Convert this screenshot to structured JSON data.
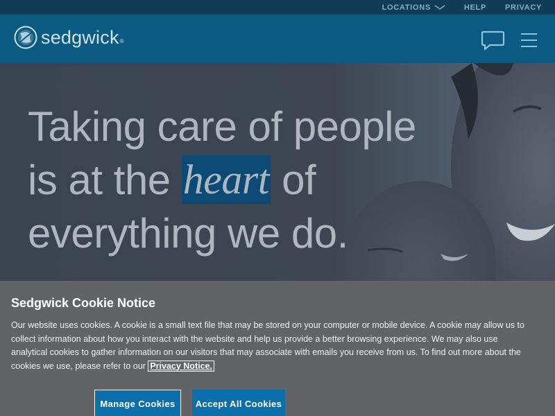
{
  "topbar": {
    "locations_label": "LOCATIONS",
    "help_label": "HELP",
    "privacy_label": "PRIVACY"
  },
  "header": {
    "logo_text": "sedgwick",
    "logo_reg": "®"
  },
  "hero": {
    "line1": "Taking care of people",
    "line2_before": "is at the ",
    "line2_highlight": "heart",
    "line2_after": " of",
    "line3": "everything we do."
  },
  "cookie": {
    "title": "Sedgwick Cookie Notice",
    "body": "Our website uses cookies. A cookie is a small text file that may be stored on your computer or mobile device. A cookie may allow us to collect information about how you interact with the website and help us provide a better browsing experience. We may also use analytical cookies to gather information on our visitors that may associate with emails you receive from us. To find out more about the cookies we use, please refer to our ",
    "privacy_link": "Privacy Notice.",
    "manage_button": "Manage Cookies",
    "accept_button": "Accept All Cookies"
  },
  "colors": {
    "topbar_bg": "#0f3d57",
    "header_bg": "#0b5a82",
    "highlight_bg": "#0b4a74",
    "cookie_bg": "#616367",
    "button_bg": "#0a6fab"
  }
}
